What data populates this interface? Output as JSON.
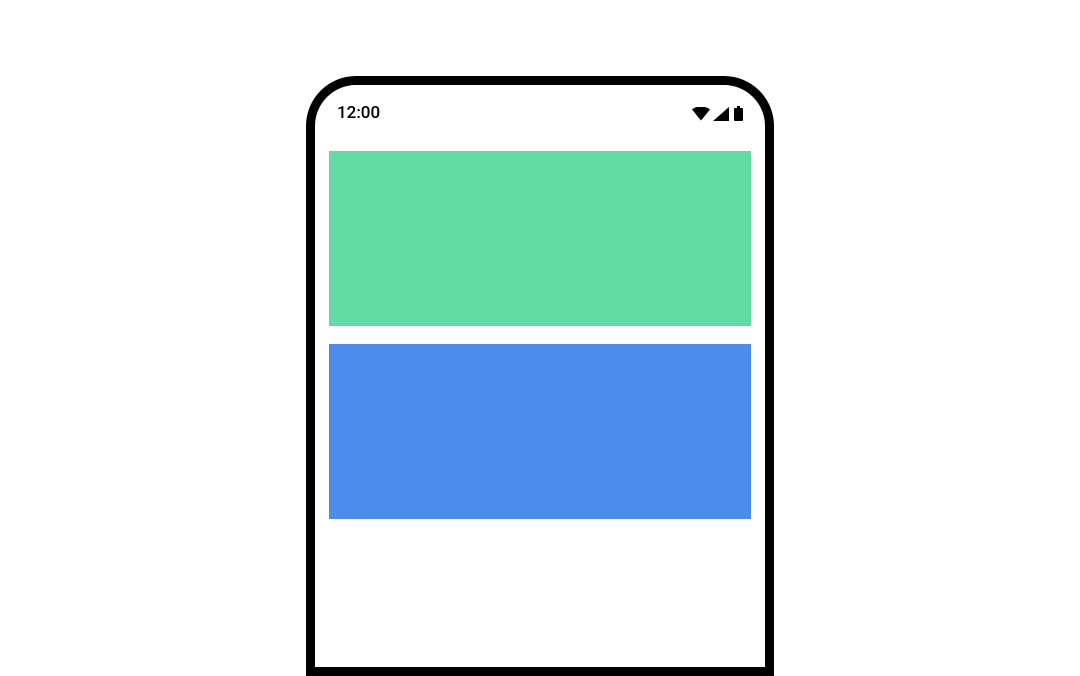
{
  "status_bar": {
    "time": "12:00"
  },
  "blocks": {
    "one": {
      "color": "#63D9A3"
    },
    "two": {
      "color": "#4C8DEB"
    }
  }
}
